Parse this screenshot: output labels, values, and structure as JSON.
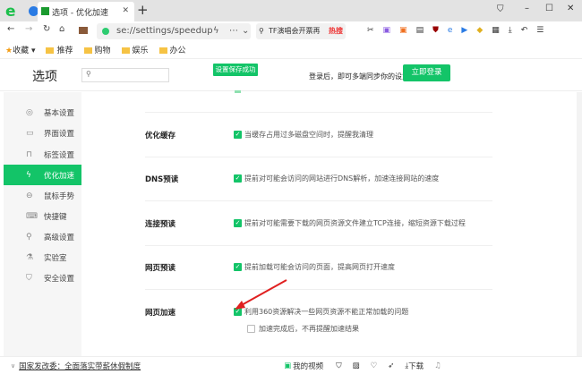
{
  "browser": {
    "tab_title": "选项 - 优化加速",
    "new_tab": "+",
    "address": "se://settings/speedup",
    "search_text": "TF演唱会开票再",
    "hot_label": "热搜"
  },
  "bookmarks": {
    "favorites": "收藏",
    "folders": [
      "推荐",
      "购物",
      "娱乐",
      "办公"
    ]
  },
  "header": {
    "title": "选项",
    "search_placeholder": "",
    "toast": "设置保存成功",
    "login_hint": "登录后，即可多端同步你的设置",
    "login_button": "立即登录"
  },
  "sidebar": {
    "items": [
      {
        "label": "基本设置",
        "icon": "◎"
      },
      {
        "label": "界面设置",
        "icon": "▭"
      },
      {
        "label": "标签设置",
        "icon": "⊓"
      },
      {
        "label": "优化加速",
        "icon": "ϟ",
        "active": true
      },
      {
        "label": "鼠标手势",
        "icon": "⊖"
      },
      {
        "label": "快捷键",
        "icon": "⌨"
      },
      {
        "label": "高级设置",
        "icon": "⚲"
      },
      {
        "label": "实验室",
        "icon": "⚗"
      },
      {
        "label": "安全设置",
        "icon": "⛉"
      }
    ]
  },
  "settings": [
    {
      "label": "优化缓存",
      "option": "当缓存占用过多磁盘空间时，提醒我清理",
      "checked": true
    },
    {
      "label": "DNS预读",
      "option": "提前对可能会访问的网站进行DNS解析，加速连接网站的速度",
      "checked": true
    },
    {
      "label": "连接预读",
      "option": "提前对可能需要下载的网页资源文件建立TCP连接，缩短资源下载过程",
      "checked": true
    },
    {
      "label": "网页预读",
      "option": "提前加载可能会访问的页面，提高网页打开速度",
      "checked": true
    },
    {
      "label": "网页加速",
      "option": "利用360资源解决一些网页资源不能正常加载的问题",
      "checked": true,
      "sub_option": "加速完成后，不再提醒加速结果",
      "sub_checked": false
    }
  ],
  "status": {
    "news": "国家发改委：全面落实带薪休假制度",
    "video": "我的视频",
    "download": "下载"
  },
  "colors": {
    "accent": "#13c468",
    "arrow": "#e02020"
  }
}
